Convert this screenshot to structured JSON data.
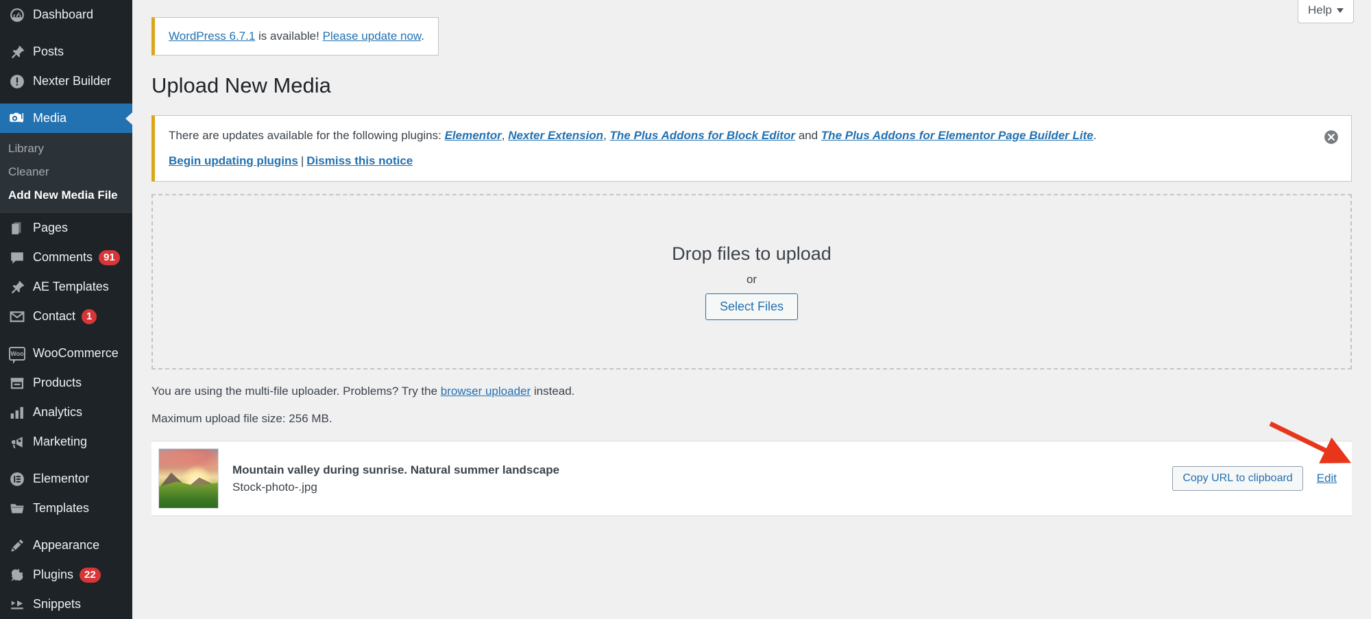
{
  "sidebar": {
    "items": [
      {
        "label": "Dashboard",
        "icon": "dashboard-icon",
        "badge": null,
        "current": false
      },
      {
        "label": "Posts",
        "icon": "pin-icon",
        "badge": null,
        "current": false
      },
      {
        "label": "Nexter Builder",
        "icon": "exclamation-circle-icon",
        "badge": null,
        "current": false
      },
      {
        "label": "Media",
        "icon": "camera-icon",
        "badge": null,
        "current": true
      },
      {
        "label": "Pages",
        "icon": "pages-icon",
        "badge": null,
        "current": false
      },
      {
        "label": "Comments",
        "icon": "comment-icon",
        "badge": "91",
        "current": false
      },
      {
        "label": "AE Templates",
        "icon": "pin-icon",
        "badge": null,
        "current": false
      },
      {
        "label": "Contact",
        "icon": "envelope-icon",
        "badge": "1",
        "current": false
      },
      {
        "label": "WooCommerce",
        "icon": "woo-icon",
        "badge": null,
        "current": false
      },
      {
        "label": "Products",
        "icon": "products-icon",
        "badge": null,
        "current": false
      },
      {
        "label": "Analytics",
        "icon": "bar-chart-icon",
        "badge": null,
        "current": false
      },
      {
        "label": "Marketing",
        "icon": "megaphone-icon",
        "badge": null,
        "current": false
      },
      {
        "label": "Elementor",
        "icon": "elementor-icon",
        "badge": null,
        "current": false
      },
      {
        "label": "Templates",
        "icon": "folder-icon",
        "badge": null,
        "current": false
      },
      {
        "label": "Appearance",
        "icon": "brush-icon",
        "badge": null,
        "current": false
      },
      {
        "label": "Plugins",
        "icon": "plug-icon",
        "badge": "22",
        "current": false
      },
      {
        "label": "Snippets",
        "icon": "snippets-icon",
        "badge": null,
        "current": false
      }
    ],
    "submenu": {
      "parent": "Media",
      "items": [
        {
          "label": "Library",
          "current": false
        },
        {
          "label": "Cleaner",
          "current": false
        },
        {
          "label": "Add New Media File",
          "current": true
        }
      ]
    }
  },
  "header": {
    "help_label": "Help"
  },
  "notices": {
    "wordpress_update": {
      "link_version": "WordPress 6.7.1",
      "middle_text": " is available! ",
      "link_update": "Please update now",
      "end_text": "."
    },
    "plugins_update": {
      "lead_text": "There are updates available for the following plugins: ",
      "plugins": [
        "Elementor",
        "Nexter Extension",
        "The Plus Addons for Block Editor",
        "The Plus Addons for Elementor Page Builder Lite"
      ],
      "separator": ", ",
      "conjunction": " and ",
      "end_text": ".",
      "action_begin": "Begin updating plugins",
      "action_separator": "|",
      "action_dismiss": "Dismiss this notice"
    }
  },
  "main": {
    "page_title": "Upload New Media",
    "dropzone": {
      "title": "Drop files to upload",
      "or": "or",
      "select_button": "Select Files"
    },
    "uploader_note": {
      "before": "You are using the multi-file uploader. Problems? Try the ",
      "link": "browser uploader",
      "after": " instead."
    },
    "max_upload": "Maximum upload file size: 256 MB.",
    "media_items": [
      {
        "title": "Mountain valley during sunrise. Natural summer landscape",
        "filename": "Stock-photo-.jpg",
        "copy_button": "Copy URL to clipboard",
        "edit_link": "Edit"
      }
    ]
  },
  "colors": {
    "sidebar_bg": "#1d2327",
    "submenu_bg": "#2c3338",
    "accent_blue": "#2271b1",
    "notice_yellow": "#dba617",
    "badge_red": "#d63638",
    "annotation_red": "#e8361a",
    "page_bg": "#f0f0f1"
  }
}
